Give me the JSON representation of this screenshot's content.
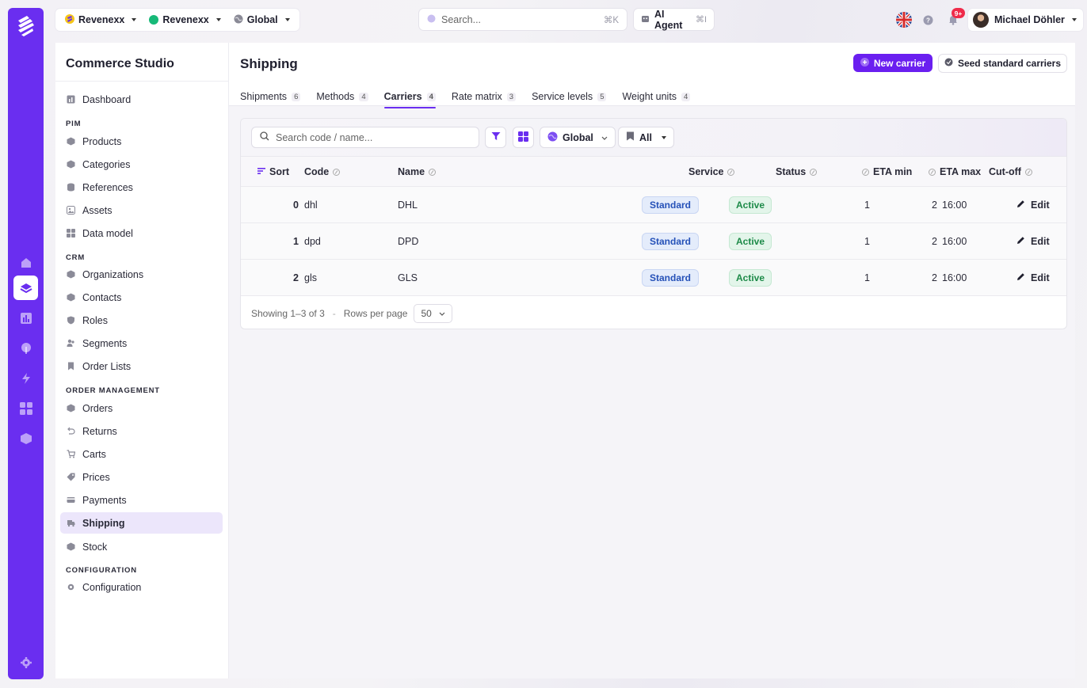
{
  "topbar": {
    "org_label": "Revenexx",
    "brand_label": "Revenexx",
    "region_label": "Global",
    "search_placeholder": "Search...",
    "search_shortcut": "⌘K",
    "agent_label": "AI Agent",
    "agent_shortcut": "⌘I",
    "notif_badge": "9+",
    "user_name": "Michael Döhler"
  },
  "sidebar": {
    "title": "Commerce Studio",
    "dashboard": "Dashboard",
    "sections": {
      "pim": "PIM",
      "crm": "CRM",
      "orders": "ORDER MANAGEMENT",
      "config": "CONFIGURATION"
    },
    "items": {
      "products": "Products",
      "categories": "Categories",
      "references": "References",
      "assets": "Assets",
      "data_model": "Data model",
      "organizations": "Organizations",
      "contacts": "Contacts",
      "roles": "Roles",
      "segments": "Segments",
      "order_lists": "Order Lists",
      "orders": "Orders",
      "returns": "Returns",
      "carts": "Carts",
      "prices": "Prices",
      "payments": "Payments",
      "shipping": "Shipping",
      "stock": "Stock",
      "configuration": "Configuration"
    }
  },
  "page": {
    "title": "Shipping",
    "new_button": "New carrier",
    "seed_button": "Seed standard carriers",
    "tabs": [
      {
        "label": "Shipments",
        "count": "6"
      },
      {
        "label": "Methods",
        "count": "4"
      },
      {
        "label": "Carriers",
        "count": "4"
      },
      {
        "label": "Rate matrix",
        "count": "3"
      },
      {
        "label": "Service levels",
        "count": "5"
      },
      {
        "label": "Weight units",
        "count": "4"
      }
    ],
    "active_tab": "Carriers"
  },
  "toolbar": {
    "search_placeholder": "Search code / name...",
    "scope_label": "Global",
    "status_label": "All"
  },
  "table": {
    "columns": {
      "sort": "Sort",
      "code": "Code",
      "name": "Name",
      "service": "Service",
      "status": "Status",
      "eta_min": "ETA min",
      "eta_max": "ETA max",
      "cutoff": "Cut-off"
    },
    "rows": [
      {
        "sort": "0",
        "code": "dhl",
        "name": "DHL",
        "service": "Standard",
        "status": "Active",
        "eta_min": "1",
        "eta_max": "2",
        "cutoff": "16:00",
        "action": "Edit"
      },
      {
        "sort": "1",
        "code": "dpd",
        "name": "DPD",
        "service": "Standard",
        "status": "Active",
        "eta_min": "1",
        "eta_max": "2",
        "cutoff": "16:00",
        "action": "Edit"
      },
      {
        "sort": "2",
        "code": "gls",
        "name": "GLS",
        "service": "Standard",
        "status": "Active",
        "eta_min": "1",
        "eta_max": "2",
        "cutoff": "16:00",
        "action": "Edit"
      }
    ],
    "footer": {
      "showing": "Showing 1–3 of 3",
      "separator": "-",
      "rows_label": "Rows per page",
      "rows_value": "50"
    }
  },
  "colors": {
    "accent": "#6a2ef0",
    "rail": "#6a2ef0",
    "badge_standard": "#2551b8",
    "badge_active": "#1d8a48"
  }
}
